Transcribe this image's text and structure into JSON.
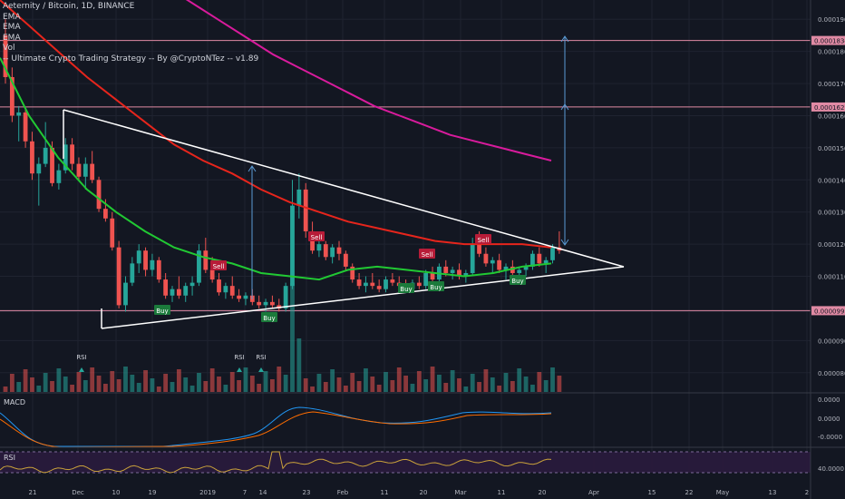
{
  "legend": {
    "title": "Aeternity / Bitcoin, 1D, BINANCE",
    "ema1": "EMA",
    "ema2": "EMA",
    "ema3": "EMA",
    "vol": "Vol",
    "strategy": "-- Ultimate Crypto Trading Strategy -- By @CryptoNTez -- v1.89"
  },
  "colors": {
    "background": "#131722",
    "up": "#26a69a",
    "down": "#ef5350",
    "ema_green": "#21c933",
    "ema_red": "#e6251c",
    "ema_magenta": "#d81b9c",
    "triangle": "#ffffff",
    "arrow": "#5b9bd5",
    "hline": "#e08aa4",
    "buy": "#1b7a3b",
    "sell": "#b71c38",
    "macd_line": "#2196f3",
    "signal_line": "#ff6d00",
    "rsi_line": "#c9a13b",
    "rsi_band": "#2a1b3d"
  },
  "panels": {
    "macd_label": "MACD",
    "rsi_label": "RSI"
  },
  "chart_data": {
    "type": "candlestick",
    "title": "Aeternity / Bitcoin, 1D, BINANCE",
    "price_axis": {
      "ticks": [
        "0.0001900",
        "0.0001800",
        "0.0001700",
        "0.0001600",
        "0.0001500",
        "0.0001400",
        "0.0001300",
        "0.0001200",
        "0.0001100",
        "0.0000990",
        "0.0000900",
        "0.0000800"
      ],
      "highlighted": [
        {
          "label": "0.0001834",
          "value": 0.0001834
        },
        {
          "label": "0.0001627",
          "value": 0.0001627
        },
        {
          "label": "0.0000993",
          "value": 9.93e-05
        }
      ]
    },
    "macd_axis": {
      "ticks": [
        "0.0000",
        "0.0000",
        "-0.0000"
      ]
    },
    "rsi_axis": {
      "ticks": [
        "40.0000"
      ]
    },
    "x_ticks": [
      "21",
      "Dec",
      "10",
      "19",
      "2019",
      "7",
      "14",
      "23",
      "Feb",
      "11",
      "20",
      "Mar",
      "11",
      "20",
      "Apr",
      "15",
      "22",
      "May",
      "13",
      "2"
    ],
    "candles_ohlc_approx": [
      [
        0.000185,
        0.00019,
        0.00017,
        0.000172
      ],
      [
        0.000172,
        0.000175,
        0.000158,
        0.00016
      ],
      [
        0.00016,
        0.000163,
        0.000152,
        0.000161
      ],
      [
        0.000161,
        0.000162,
        0.00015,
        0.000152
      ],
      [
        0.000152,
        0.000155,
        0.00014,
        0.000142
      ],
      [
        0.000142,
        0.000147,
        0.000132,
        0.000145
      ],
      [
        0.000145,
        0.000158,
        0.000144,
        0.00015
      ],
      [
        0.00015,
        0.000152,
        0.000138,
        0.000139
      ],
      [
        0.000139,
        0.000145,
        0.000137,
        0.000143
      ],
      [
        0.000143,
        0.000153,
        0.000142,
        0.000151
      ],
      [
        0.000151,
        0.000153,
        0.000143,
        0.000145
      ],
      [
        0.000145,
        0.000147,
        0.00014,
        0.000141
      ],
      [
        0.000141,
        0.000147,
        0.000137,
        0.000145
      ],
      [
        0.000145,
        0.000149,
        0.000139,
        0.00014
      ],
      [
        0.00014,
        0.000141,
        0.00013,
        0.000131
      ],
      [
        0.000131,
        0.000134,
        0.000127,
        0.000128
      ],
      [
        0.000128,
        0.00013,
        0.000118,
        0.000119
      ],
      [
        0.000119,
        0.000121,
        0.0001,
        0.000101
      ],
      [
        0.000101,
        0.00011,
        9.9e-05,
        0.000108
      ],
      [
        0.000108,
        0.000116,
        0.000107,
        0.000114
      ],
      [
        0.000114,
        0.00012,
        0.000111,
        0.000118
      ],
      [
        0.000118,
        0.000119,
        0.00011,
        0.000112
      ],
      [
        0.000112,
        0.000117,
        0.00011,
        0.000115
      ],
      [
        0.000115,
        0.000116,
        0.000108,
        0.000109
      ],
      [
        0.000109,
        0.000111,
        0.000103,
        0.000104
      ],
      [
        0.000104,
        0.000107,
        0.000102,
        0.000106
      ],
      [
        0.000106,
        0.00011,
        0.000103,
        0.000104
      ],
      [
        0.000104,
        0.000108,
        0.000102,
        0.000107
      ],
      [
        0.000107,
        0.00011,
        0.000104,
        0.000108
      ],
      [
        0.000108,
        0.00012,
        0.000107,
        0.000118
      ],
      [
        0.000118,
        0.000122,
        0.000111,
        0.000112
      ],
      [
        0.000112,
        0.000116,
        0.000108,
        0.000109
      ],
      [
        0.000109,
        0.000111,
        0.000104,
        0.000105
      ],
      [
        0.000105,
        0.000108,
        0.000103,
        0.000107
      ],
      [
        0.000107,
        0.00011,
        0.000103,
        0.000104
      ],
      [
        0.000104,
        0.000106,
        0.000102,
        0.000103
      ],
      [
        0.000103,
        0.000105,
        0.000101,
        0.000104
      ],
      [
        0.000104,
        0.000106,
        0.000101,
        0.000102
      ],
      [
        0.000102,
        0.000104,
        0.0001,
        0.000101
      ],
      [
        0.000101,
        0.000103,
        9.9e-05,
        0.000102
      ],
      [
        0.000102,
        0.000104,
        0.0001,
        0.000101
      ],
      [
        0.000101,
        0.000103,
        9.9e-05,
        0.0001
      ],
      [
        0.0001,
        0.000108,
        9.9e-05,
        0.000107
      ],
      [
        0.000107,
        0.00014,
        0.000106,
        0.000132
      ],
      [
        0.000132,
        0.000142,
        0.000128,
        0.000137
      ],
      [
        0.000137,
        0.000139,
        0.000122,
        0.000124
      ],
      [
        0.000124,
        0.000127,
        0.000117,
        0.000118
      ],
      [
        0.000118,
        0.000122,
        0.000116,
        0.00012
      ],
      [
        0.00012,
        0.000121,
        0.000115,
        0.000116
      ],
      [
        0.000116,
        0.00012,
        0.000114,
        0.000119
      ],
      [
        0.000119,
        0.000121,
        0.000115,
        0.000117
      ],
      [
        0.000117,
        0.000118,
        0.000112,
        0.000113
      ],
      [
        0.000113,
        0.000114,
        0.000108,
        0.000109
      ],
      [
        0.000109,
        0.000111,
        0.000106,
        0.000107
      ],
      [
        0.000107,
        0.00011,
        0.000105,
        0.000108
      ],
      [
        0.000108,
        0.000111,
        0.000106,
        0.000107
      ],
      [
        0.000107,
        0.000109,
        0.000105,
        0.000106
      ],
      [
        0.000106,
        0.00011,
        0.000105,
        0.000109
      ],
      [
        0.000109,
        0.000111,
        0.000107,
        0.000108
      ],
      [
        0.000108,
        0.00011,
        0.000106,
        0.000107
      ],
      [
        0.000107,
        0.000109,
        0.000105,
        0.000106
      ],
      [
        0.000106,
        0.000109,
        0.000105,
        0.000108
      ],
      [
        0.000108,
        0.00011,
        0.000106,
        0.000107
      ],
      [
        0.000107,
        0.000112,
        0.000106,
        0.000111
      ],
      [
        0.000111,
        0.000113,
        0.000108,
        0.000109
      ],
      [
        0.000109,
        0.000114,
        0.000108,
        0.000113
      ],
      [
        0.000113,
        0.000115,
        0.00011,
        0.000111
      ],
      [
        0.000111,
        0.000113,
        0.000109,
        0.000112
      ],
      [
        0.000112,
        0.000114,
        0.000109,
        0.00011
      ],
      [
        0.00011,
        0.000112,
        0.000108,
        0.000111
      ],
      [
        0.000111,
        0.000122,
        0.00011,
        0.00012
      ],
      [
        0.00012,
        0.000124,
        0.000116,
        0.000117
      ],
      [
        0.000117,
        0.000119,
        0.000113,
        0.000114
      ],
      [
        0.000114,
        0.000116,
        0.000111,
        0.000115
      ],
      [
        0.000115,
        0.000117,
        0.000111,
        0.000112
      ],
      [
        0.000112,
        0.000114,
        0.000109,
        0.000113
      ],
      [
        0.000113,
        0.000115,
        0.00011,
        0.000111
      ],
      [
        0.000111,
        0.000113,
        0.000109,
        0.000112
      ],
      [
        0.000112,
        0.000114,
        0.00011,
        0.000113
      ],
      [
        0.000113,
        0.000118,
        0.000112,
        0.000117
      ],
      [
        0.000117,
        0.000119,
        0.000113,
        0.000114
      ],
      [
        0.000114,
        0.000116,
        0.000111,
        0.000115
      ],
      [
        0.000115,
        0.00012,
        0.000114,
        0.000119
      ],
      [
        0.000119,
        0.000124,
        0.000117,
        0.000118
      ]
    ],
    "ema_green": [
      0.000178,
      0.00016,
      0.000147,
      0.000137,
      0.00013,
      0.000124,
      0.000119,
      0.000116,
      0.000114,
      0.000111,
      0.00011,
      0.000109,
      0.000112,
      0.000113,
      0.000112,
      0.000111,
      0.00011,
      0.000111,
      0.000113,
      0.000114
    ],
    "ema_red": [
      0.000196,
      0.000188,
      0.00018,
      0.000172,
      0.000165,
      0.000158,
      0.000151,
      0.000146,
      0.000142,
      0.000137,
      0.000133,
      0.00013,
      0.000127,
      0.000125,
      0.000123,
      0.000121,
      0.00012,
      0.00012,
      0.00012,
      0.000119
    ],
    "ema_magenta": [
      0.000199,
      0.000194,
      0.000189,
      0.000184,
      0.000179,
      0.000175,
      0.000171,
      0.000167,
      0.000163,
      0.00016,
      0.000157,
      0.000154,
      0.000152,
      0.00015,
      0.000148,
      0.000146
    ],
    "annotations": {
      "buy_labels": [
        "Buy",
        "Buy",
        "Buy",
        "Buy",
        "Buy"
      ],
      "sell_labels": [
        "Sell",
        "Sell",
        "Sell",
        "Sell"
      ],
      "rsi_labels": [
        "RSI",
        "RSI",
        "RSI"
      ]
    }
  }
}
